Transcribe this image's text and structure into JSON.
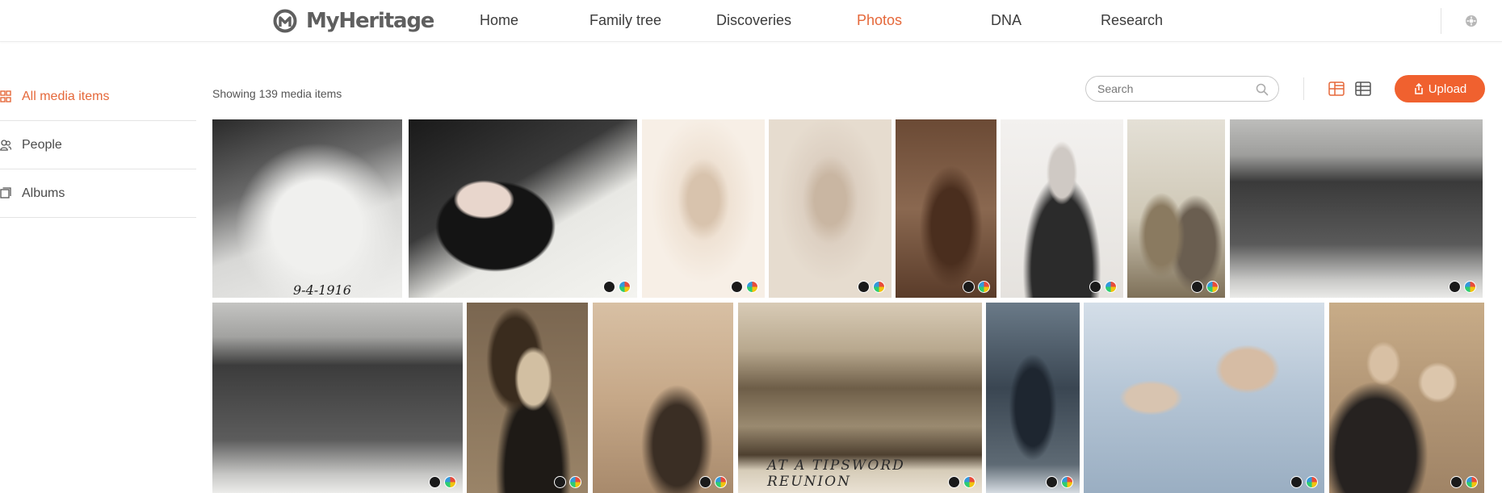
{
  "brand": {
    "name": "MyHeritage",
    "accent": "#e5683a",
    "upload_color": "#f0612f"
  },
  "nav": {
    "items": [
      {
        "label": "Home"
      },
      {
        "label": "Family tree"
      },
      {
        "label": "Discoveries"
      },
      {
        "label": "Photos",
        "active": true
      },
      {
        "label": "DNA"
      },
      {
        "label": "Research"
      }
    ]
  },
  "sidebar": {
    "items": [
      {
        "label": "All media items",
        "icon": "grid-icon",
        "active": true
      },
      {
        "label": "People",
        "icon": "people-icon"
      },
      {
        "label": "Albums",
        "icon": "albums-icon"
      }
    ]
  },
  "toolbar": {
    "showing_text": "Showing 139 media items",
    "search_placeholder": "Search",
    "search_value": "",
    "upload_label": "Upload"
  },
  "photos": [
    {
      "name": "photo-four-girls-outdoors",
      "tone": "bw",
      "caption": "9-4-1916"
    },
    {
      "name": "photo-woman-at-piano",
      "tone": "color",
      "enhanced": true,
      "colorized": true
    },
    {
      "name": "photo-young-woman-portrait-sepia",
      "tone": "sepia-light",
      "enhanced": true,
      "colorized": true
    },
    {
      "name": "photo-young-woman-portrait-faded",
      "tone": "sepia-faded",
      "enhanced": true,
      "colorized": true
    },
    {
      "name": "photo-woman-standing-victorian",
      "tone": "sepia-dark",
      "enhanced": true,
      "colorized": true
    },
    {
      "name": "photo-man-with-glasses",
      "tone": "bw-light",
      "enhanced": true,
      "colorized": true
    },
    {
      "name": "photo-two-women-outside-house",
      "tone": "color-faded",
      "enhanced": true,
      "colorized": true
    },
    {
      "name": "photo-group-women-row-1",
      "tone": "bw",
      "enhanced": true,
      "colorized": true
    },
    {
      "name": "photo-group-women-row-2",
      "tone": "bw",
      "enhanced": true,
      "colorized": true
    },
    {
      "name": "photo-woman-finger-waves",
      "tone": "sepia",
      "enhanced": true,
      "colorized": true
    },
    {
      "name": "photo-two-women-embracing",
      "tone": "sepia-light",
      "enhanced": true,
      "colorized": true
    },
    {
      "name": "photo-tipsword-reunion",
      "tone": "sepia",
      "caption": "AT A TIPSWORD REUNION",
      "enhanced": true,
      "colorized": true
    },
    {
      "name": "photo-couple-in-woods",
      "tone": "blue",
      "enhanced": true,
      "colorized": true
    },
    {
      "name": "photo-boy-and-man",
      "tone": "blue-color",
      "enhanced": true,
      "colorized": true
    },
    {
      "name": "photo-couple-studio",
      "tone": "sepia",
      "enhanced": true,
      "colorized": true
    }
  ]
}
